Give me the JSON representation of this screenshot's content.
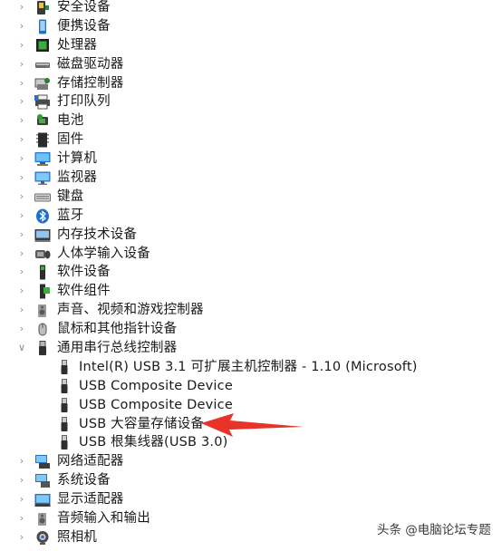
{
  "tree": {
    "items": [
      {
        "label": "安全设备",
        "icon": "security-device-icon",
        "expanded": false
      },
      {
        "label": "便携设备",
        "icon": "portable-device-icon",
        "expanded": false
      },
      {
        "label": "处理器",
        "icon": "processor-icon",
        "expanded": false
      },
      {
        "label": "磁盘驱动器",
        "icon": "disk-drive-icon",
        "expanded": false
      },
      {
        "label": "存储控制器",
        "icon": "storage-controller-icon",
        "expanded": false
      },
      {
        "label": "打印队列",
        "icon": "printer-icon",
        "expanded": false
      },
      {
        "label": "电池",
        "icon": "battery-icon",
        "expanded": false
      },
      {
        "label": "固件",
        "icon": "firmware-icon",
        "expanded": false
      },
      {
        "label": "计算机",
        "icon": "computer-icon",
        "expanded": false
      },
      {
        "label": "监视器",
        "icon": "monitor-icon",
        "expanded": false
      },
      {
        "label": "键盘",
        "icon": "keyboard-icon",
        "expanded": false
      },
      {
        "label": "蓝牙",
        "icon": "bluetooth-icon",
        "expanded": false
      },
      {
        "label": "内存技术设备",
        "icon": "memory-technology-icon",
        "expanded": false
      },
      {
        "label": "人体学输入设备",
        "icon": "hid-icon",
        "expanded": false
      },
      {
        "label": "软件设备",
        "icon": "software-device-icon",
        "expanded": false
      },
      {
        "label": "软件组件",
        "icon": "software-component-icon",
        "expanded": false
      },
      {
        "label": "声音、视频和游戏控制器",
        "icon": "speaker-icon",
        "expanded": false
      },
      {
        "label": "鼠标和其他指针设备",
        "icon": "mouse-icon",
        "expanded": false
      },
      {
        "label": "通用串行总线控制器",
        "icon": "usb-controller-icon",
        "expanded": true,
        "children": [
          {
            "label": "Intel(R) USB 3.1 可扩展主机控制器 - 1.10 (Microsoft)",
            "icon": "usb-plug-icon"
          },
          {
            "label": "USB Composite Device",
            "icon": "usb-plug-icon"
          },
          {
            "label": "USB Composite Device",
            "icon": "usb-plug-icon"
          },
          {
            "label": "USB 大容量存储设备",
            "icon": "usb-plug-icon"
          },
          {
            "label": "USB 根集线器(USB 3.0)",
            "icon": "usb-plug-icon"
          }
        ]
      },
      {
        "label": "网络适配器",
        "icon": "network-adapter-icon",
        "expanded": false
      },
      {
        "label": "系统设备",
        "icon": "system-device-icon",
        "expanded": false
      },
      {
        "label": "显示适配器",
        "icon": "display-adapter-icon",
        "expanded": false
      },
      {
        "label": "音频输入和输出",
        "icon": "audio-io-icon",
        "expanded": false
      },
      {
        "label": "照相机",
        "icon": "camera-icon",
        "expanded": false
      }
    ]
  },
  "annotation": {
    "arrow_color": "#e8332a",
    "points_to": "USB 大容量存储设备"
  },
  "watermark": {
    "text": "头条 @电脑论坛专题"
  },
  "colors": {
    "chevron": "#8a8a8a",
    "text": "#1a1a1a",
    "arrow": "#e8332a"
  }
}
